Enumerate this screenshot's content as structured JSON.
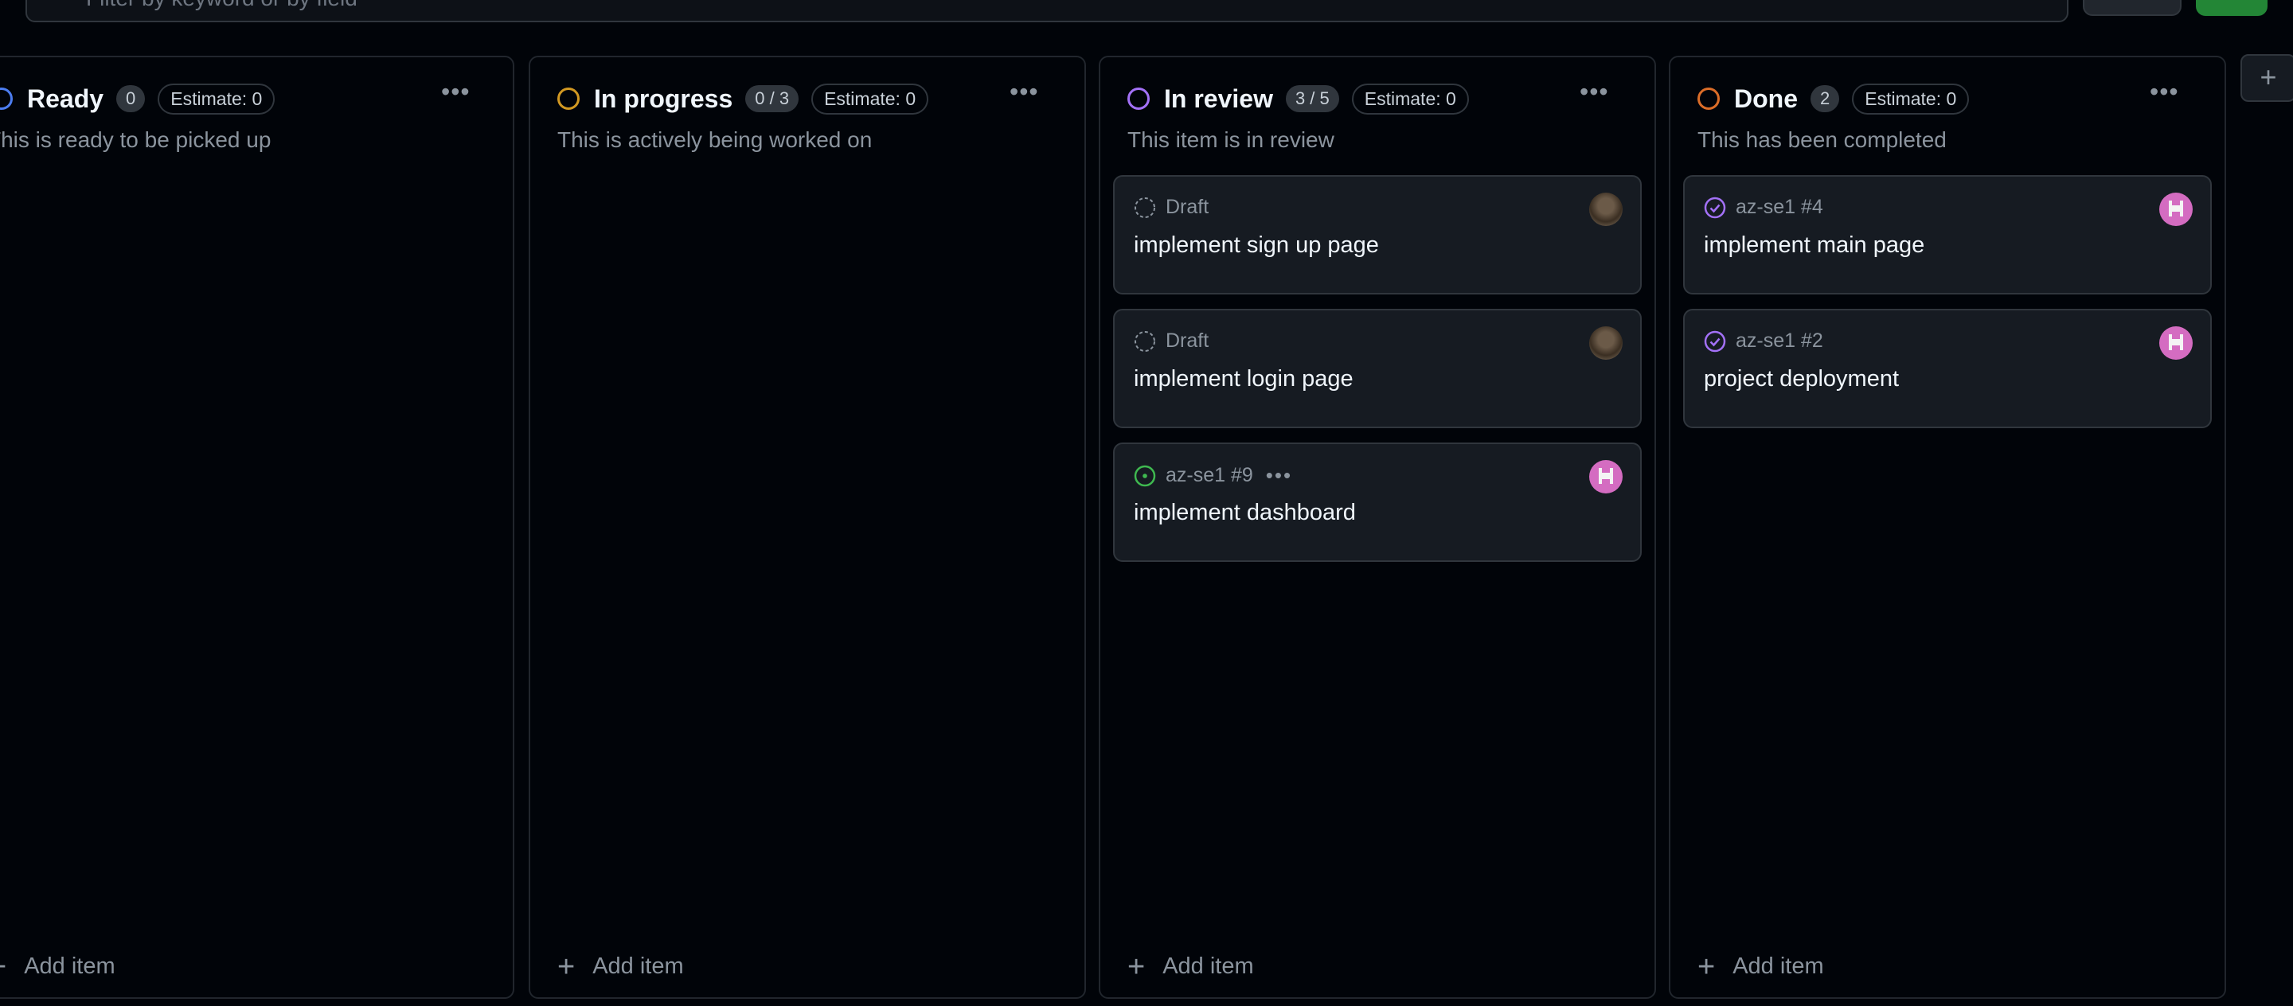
{
  "filter": {
    "placeholder": "Filter by keyword or by field"
  },
  "columns": [
    {
      "title": "Ready",
      "count": "0",
      "estimate": "Estimate: 0",
      "description": "This is ready to be picked up",
      "status_color": "#4c7df0",
      "add_label": "Add item",
      "cards": []
    },
    {
      "title": "In progress",
      "count": "0 / 3",
      "estimate": "Estimate: 0",
      "description": "This is actively being worked on",
      "status_color": "#d29922",
      "add_label": "Add item",
      "cards": []
    },
    {
      "title": "In review",
      "count": "3 / 5",
      "estimate": "Estimate: 0",
      "description": "This item is in review",
      "status_color": "#a371f7",
      "add_label": "Add item",
      "cards": [
        {
          "meta": "Draft",
          "title": "implement sign up page",
          "icon": "draft-icon",
          "avatar": "photo"
        },
        {
          "meta": "Draft",
          "title": "implement login page",
          "icon": "draft-icon",
          "avatar": "photo"
        },
        {
          "meta": "az-se1 #9",
          "title": "implement dashboard",
          "icon": "open-issue-icon",
          "avatar": "pixel"
        }
      ]
    },
    {
      "title": "Done",
      "count": "2",
      "estimate": "Estimate: 0",
      "description": "This has been completed",
      "status_color": "#db6d28",
      "add_label": "Add item",
      "cards": [
        {
          "meta": "az-se1 #4",
          "title": "implement main page",
          "icon": "closed-issue-icon",
          "avatar": "pixel"
        },
        {
          "meta": "az-se1 #2",
          "title": "project deployment",
          "icon": "closed-issue-icon",
          "avatar": "pixel"
        }
      ]
    }
  ],
  "add_column_label": "+"
}
